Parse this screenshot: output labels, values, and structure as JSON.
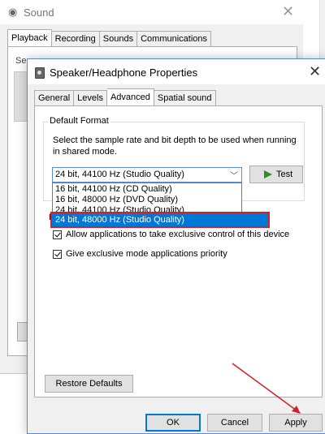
{
  "sound_window": {
    "title": "Sound",
    "title_icon": "speaker-icon",
    "close_glyph": "✕",
    "tabs": [
      "Playback",
      "Recording",
      "Sounds",
      "Communications"
    ],
    "active_tab": "Playback",
    "panel_text": "Se"
  },
  "dialog": {
    "title": "Speaker/Headphone Properties",
    "title_icon": "speaker-icon",
    "close_glyph": "✕",
    "tabs": [
      "General",
      "Levels",
      "Advanced",
      "Spatial sound"
    ],
    "active_tab": "Advanced",
    "default_format": {
      "group_label": "Default Format",
      "description": "Select the sample rate and bit depth to be used when running in shared mode.",
      "selected_value": "24 bit, 44100 Hz (Studio Quality)",
      "test_label": "Test",
      "options": [
        "16 bit, 44100 Hz (CD Quality)",
        "16 bit, 48000 Hz (DVD Quality)",
        "24 bit, 44100 Hz (Studio Quality)",
        "24 bit, 48000 Hz (Studio Quality)"
      ],
      "highlighted_option": "24 bit, 48000 Hz (Studio Quality)"
    },
    "exclusive_mode": {
      "group_label": "E",
      "options": [
        {
          "label": "Allow applications to take exclusive control of this device",
          "checked": true
        },
        {
          "label": "Give exclusive mode applications priority",
          "checked": true
        }
      ]
    },
    "restore_defaults_label": "Restore Defaults",
    "ok_label": "OK",
    "cancel_label": "Cancel",
    "apply_label": "Apply"
  },
  "colors": {
    "accent": "#0078d7",
    "highlight_border": "#d3212a",
    "arrow": "#d3212a",
    "play_icon": "#2e8b2e"
  }
}
